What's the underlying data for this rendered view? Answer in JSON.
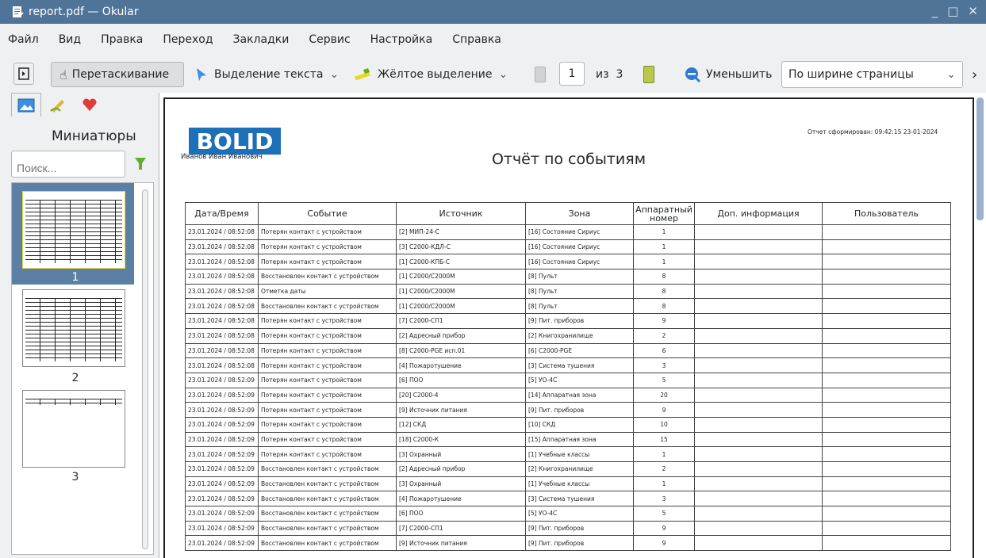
{
  "window": {
    "title": "report.pdf — Okular"
  },
  "menu": [
    "Файл",
    "Вид",
    "Правка",
    "Переход",
    "Закладки",
    "Сервис",
    "Настройка",
    "Справка"
  ],
  "toolbar": {
    "drag_label": "Перетаскивание",
    "select_text_label": "Выделение текста",
    "yellow_label": "Жёлтое выделение",
    "page_value": "1",
    "page_of": "из",
    "page_total": "3",
    "zoom_out_label": "Уменьшить",
    "zoom_mode": "По ширине страницы"
  },
  "sidebar": {
    "title": "Миниатюры",
    "search_placeholder": "Поиск...",
    "thumbs": [
      "1",
      "2",
      "3"
    ]
  },
  "report": {
    "logo": "BOLID",
    "author": "Иванов Иван Иванович",
    "title": "Отчёт по событиям",
    "generated": "Отчет сформирован:   09:42:15 23-01-2024",
    "columns": [
      "Дата/Время",
      "Событие",
      "Источник",
      "Зона",
      "Аппаратный номер",
      "Доп. информация",
      "Пользователь"
    ],
    "rows": [
      [
        "23.01.2024 / 08:52:08",
        "Потерян контакт с устройством",
        "[2] МИП-24-С",
        "[16] Состояние Сириус",
        "1",
        "",
        ""
      ],
      [
        "23.01.2024 / 08:52:08",
        "Потерян контакт с устройством",
        "[3] С2000-КДЛ-С",
        "[16] Состояние Сириус",
        "1",
        "",
        ""
      ],
      [
        "23.01.2024 / 08:52:08",
        "Потерян контакт с устройством",
        "[1] С2000-КПБ-С",
        "[16] Состояние Сириус",
        "1",
        "",
        ""
      ],
      [
        "23.01.2024 / 08:52:08",
        "Восстановлен контакт с устройством",
        "[1] С2000/С2000М",
        "[8] Пульт",
        "8",
        "",
        ""
      ],
      [
        "23.01.2024 / 08:52:08",
        "Отметка даты",
        "[1] С2000/С2000М",
        "[8] Пульт",
        "8",
        "",
        ""
      ],
      [
        "23.01.2024 / 08:52:08",
        "Восстановлен контакт с устройством",
        "[1] С2000/С2000М",
        "[8] Пульт",
        "8",
        "",
        ""
      ],
      [
        "23.01.2024 / 08:52:08",
        "Потерян контакт с устройством",
        "[7] С2000-СП1",
        "[9] Пит. приборов",
        "9",
        "",
        ""
      ],
      [
        "23.01.2024 / 08:52:08",
        "Потерян контакт с устройством",
        "[2] Адресный прибор",
        "[2] Книгохранилище",
        "2",
        "",
        ""
      ],
      [
        "23.01.2024 / 08:52:08",
        "Потерян контакт с устройством",
        "[8] C2000-PGE исп.01",
        "[6] C2000-PGE",
        "6",
        "",
        ""
      ],
      [
        "23.01.2024 / 08:52:08",
        "Потерян контакт с устройством",
        "[4] Пожаротушение",
        "[3] Система тушения",
        "3",
        "",
        ""
      ],
      [
        "23.01.2024 / 08:52:09",
        "Потерян контакт с устройством",
        "[6] ПОО",
        "[5] УО-4С",
        "5",
        "",
        ""
      ],
      [
        "23.01.2024 / 08:52:09",
        "Потерян контакт с устройством",
        "[20] С2000-4",
        "[14] Аппаратная зона",
        "20",
        "",
        ""
      ],
      [
        "23.01.2024 / 08:52:09",
        "Потерян контакт с устройством",
        "[9] Источник питания",
        "[9] Пит. приборов",
        "9",
        "",
        ""
      ],
      [
        "23.01.2024 / 08:52:09",
        "Потерян контакт с устройством",
        "[12] СКД",
        "[10] СКД",
        "10",
        "",
        ""
      ],
      [
        "23.01.2024 / 08:52:09",
        "Потерян контакт с устройством",
        "[18] С2000-К",
        "[15] Аппаратная зона",
        "15",
        "",
        ""
      ],
      [
        "23.01.2024 / 08:52:09",
        "Потерян контакт с устройством",
        "[3] Охранный",
        "[1] Учебные классы",
        "1",
        "",
        ""
      ],
      [
        "23.01.2024 / 08:52:09",
        "Восстановлен контакт с устройством",
        "[2] Адресный прибор",
        "[2] Книгохранилище",
        "2",
        "",
        ""
      ],
      [
        "23.01.2024 / 08:52:09",
        "Восстановлен контакт с устройством",
        "[3] Охранный",
        "[1] Учебные классы",
        "1",
        "",
        ""
      ],
      [
        "23.01.2024 / 08:52:09",
        "Восстановлен контакт с устройством",
        "[4] Пожаротушение",
        "[3] Система тушения",
        "3",
        "",
        ""
      ],
      [
        "23.01.2024 / 08:52:09",
        "Восстановлен контакт с устройством",
        "[6] ПОО",
        "[5] УО-4С",
        "5",
        "",
        ""
      ],
      [
        "23.01.2024 / 08:52:09",
        "Восстановлен контакт с устройством",
        "[7] С2000-СП1",
        "[9] Пит. приборов",
        "9",
        "",
        ""
      ],
      [
        "23.01.2024 / 08:52:09",
        "Восстановлен контакт с устройством",
        "[9] Источник питания",
        "[9] Пит. приборов",
        "9",
        "",
        ""
      ]
    ]
  }
}
